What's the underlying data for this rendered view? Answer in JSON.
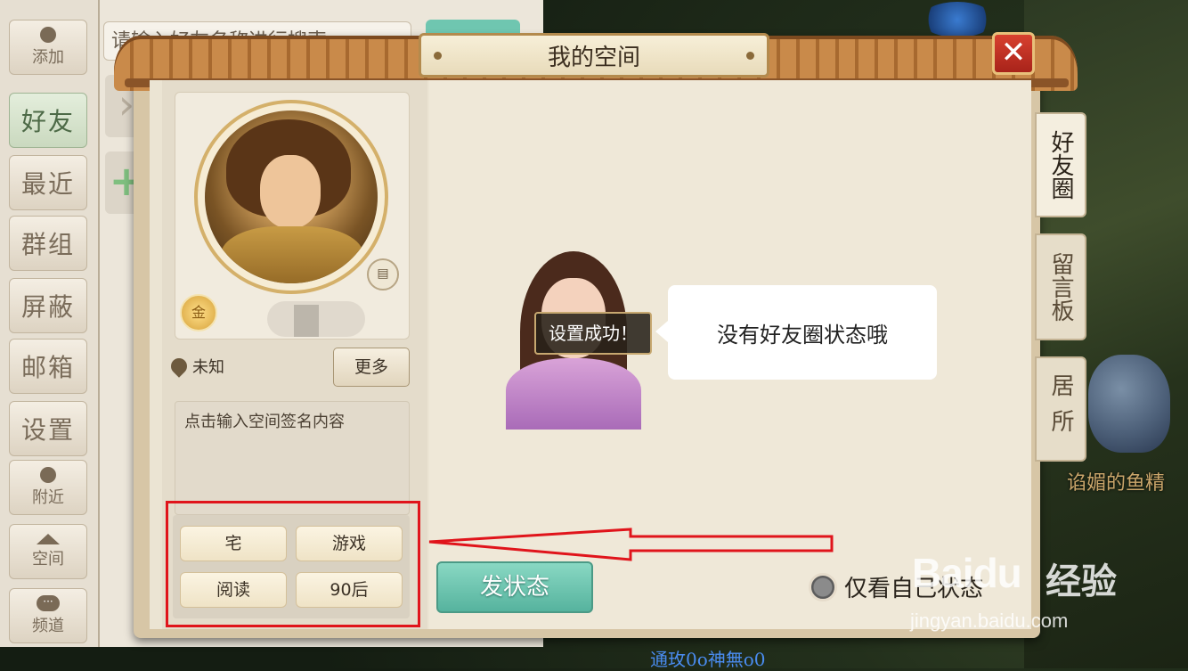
{
  "window": {
    "title": "我的空间",
    "close_label": "✕"
  },
  "left_nav": [
    {
      "label": "添加",
      "icon": "add-friend-icon",
      "style": "small"
    },
    {
      "label": "好友",
      "style": "big",
      "active": true
    },
    {
      "label": "最近",
      "style": "big"
    },
    {
      "label": "群组",
      "style": "big"
    },
    {
      "label": "屏蔽",
      "style": "big"
    },
    {
      "label": "邮箱",
      "style": "big"
    },
    {
      "label": "设置",
      "style": "big"
    },
    {
      "label": "附近",
      "icon": "nearby-icon",
      "style": "small"
    },
    {
      "label": "空间",
      "icon": "house-icon",
      "style": "small"
    },
    {
      "label": "频道",
      "icon": "chat-bubble-icon",
      "style": "small"
    }
  ],
  "search": {
    "placeholder": "请输入好友名称进行搜索"
  },
  "profile": {
    "badge_label": "金",
    "location": "未知",
    "more_label": "更多",
    "signature_placeholder": "点击输入空间签名内容",
    "tags": [
      "宅",
      "游戏",
      "阅读",
      "90后"
    ]
  },
  "feed": {
    "toast": "设置成功！",
    "empty_message": "没有好友圈状态哦",
    "post_button": "发状态",
    "self_only_label": "仅看自己状态"
  },
  "side_tabs": [
    {
      "label": "好友圈",
      "active": true
    },
    {
      "label": "留言板",
      "active": false
    },
    {
      "label": "居所",
      "active": false
    }
  ],
  "scene": {
    "monster_name": "谄媚的鱼精",
    "player_name": "通玫0o神無o0"
  },
  "watermark": {
    "brand": "Baidu",
    "brand_cn": "经验",
    "url": "jingyan.baidu.com"
  },
  "colors": {
    "accent_green": "#6fc6b0",
    "highlight_red": "#e0141b",
    "wood": "#a7692f"
  }
}
